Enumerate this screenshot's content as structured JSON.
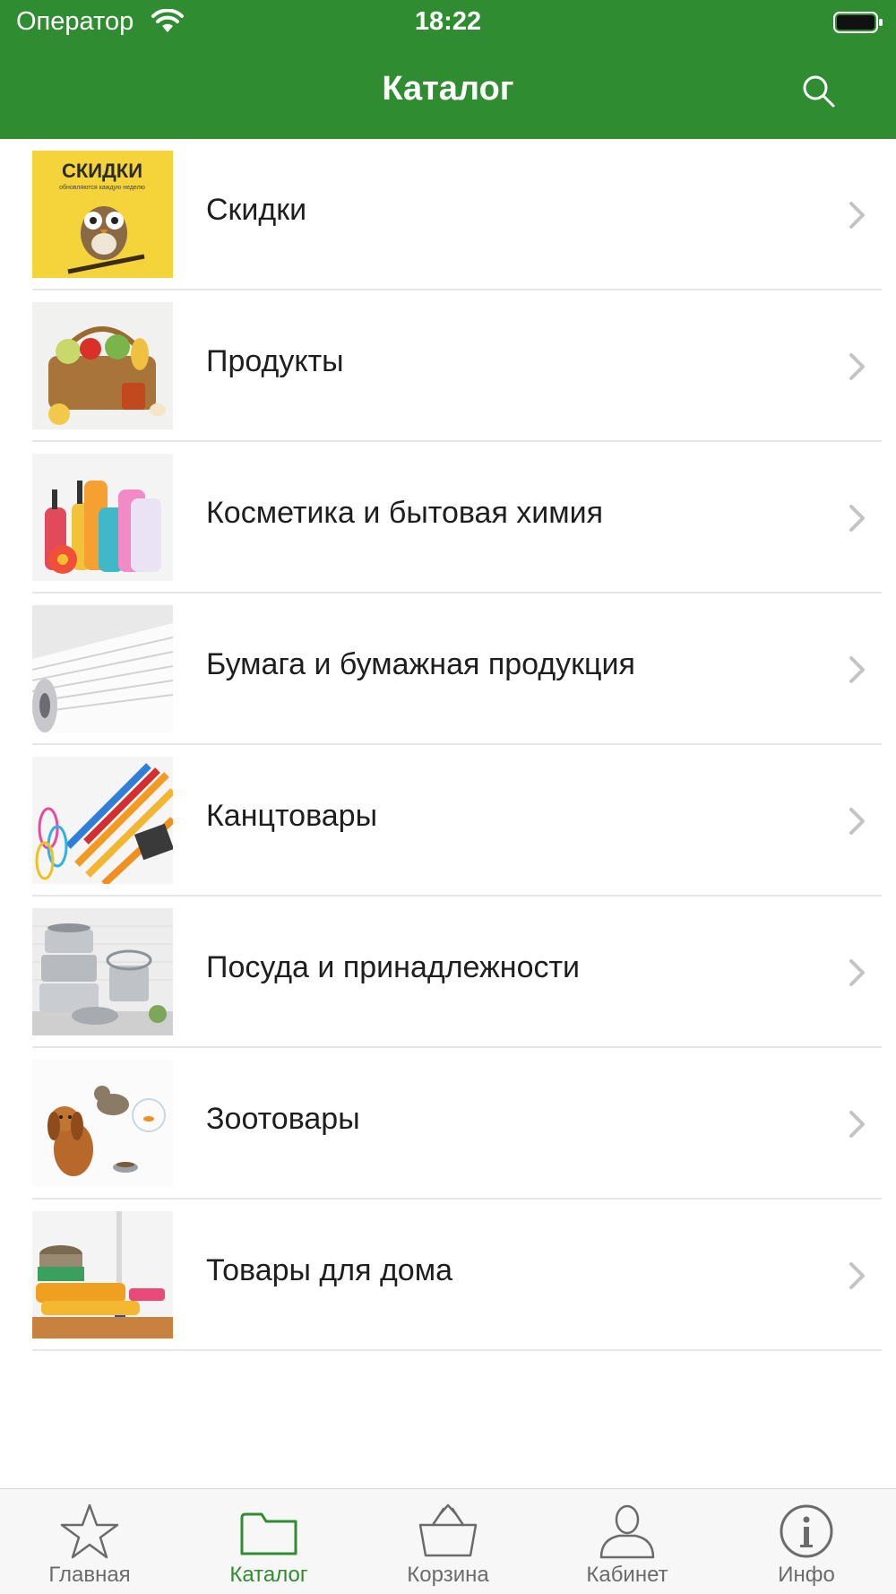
{
  "status_bar": {
    "carrier": "Оператор",
    "time": "18:22"
  },
  "nav": {
    "title": "Каталог"
  },
  "catalog": {
    "items": [
      {
        "label": "Скидки",
        "thumb_title": "СКИДКИ",
        "thumb_subtitle": "обновляются каждую неделю"
      },
      {
        "label": "Продукты"
      },
      {
        "label": "Косметика и бытовая химия"
      },
      {
        "label": "Бумага и бумажная продукция"
      },
      {
        "label": "Канцтовары"
      },
      {
        "label": "Посуда и принадлежности"
      },
      {
        "label": "Зоотовары"
      },
      {
        "label": "Товары для дома"
      }
    ]
  },
  "tabbar": {
    "tabs": [
      {
        "label": "Главная",
        "icon": "star-icon"
      },
      {
        "label": "Каталог",
        "icon": "folder-icon",
        "active": true
      },
      {
        "label": "Корзина",
        "icon": "basket-icon"
      },
      {
        "label": "Кабинет",
        "icon": "person-icon"
      },
      {
        "label": "Инфо",
        "icon": "info-icon"
      }
    ]
  },
  "colors": {
    "brand_green": "#2f8c30",
    "tab_inactive": "#6b6b6b",
    "tab_bar_bg": "#f7f7f7"
  }
}
